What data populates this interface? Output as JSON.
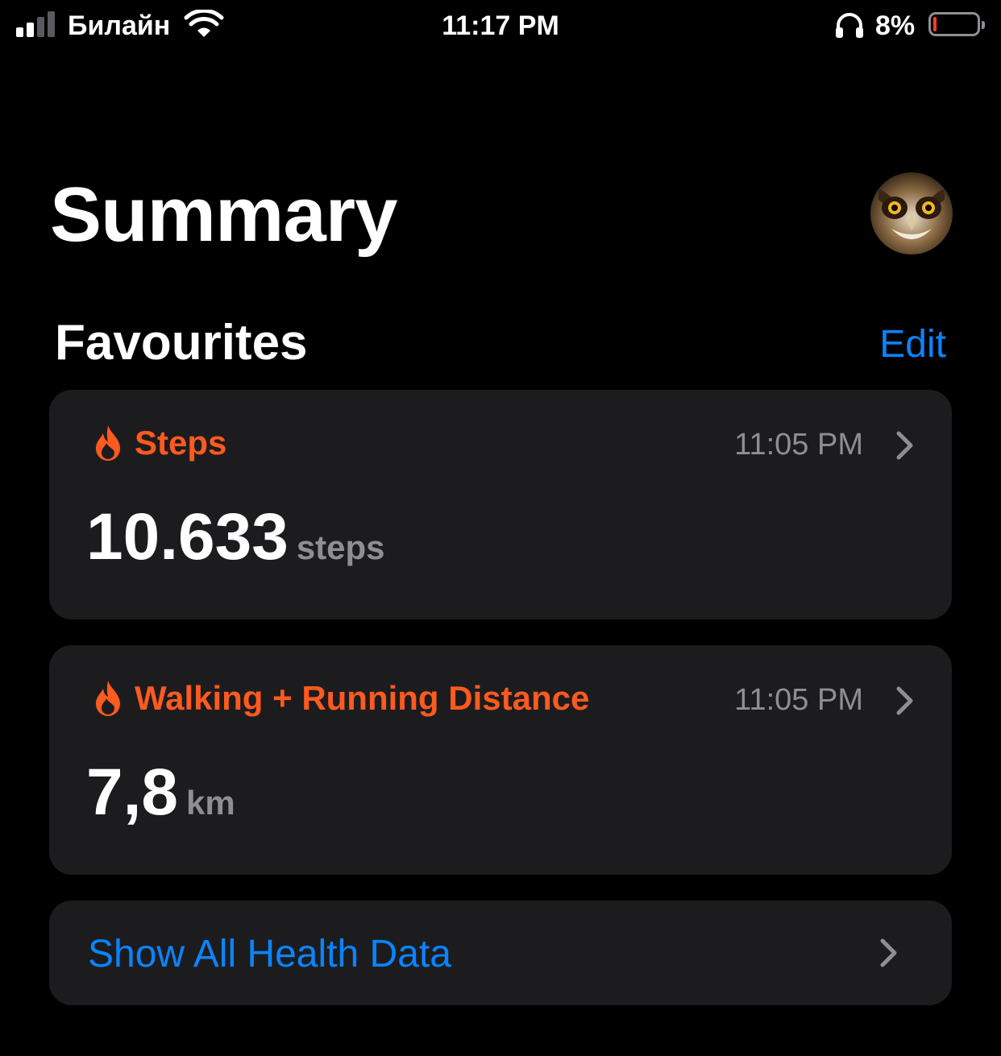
{
  "status_bar": {
    "carrier": "Билайн",
    "time": "11:17 PM",
    "battery_percent": "8%",
    "battery_level": 0.08,
    "signal_bars_active": 2,
    "signal_bars_total": 4,
    "icons": [
      "signal-icon",
      "wifi-icon",
      "headphones-icon",
      "battery-icon"
    ]
  },
  "header": {
    "title": "Summary",
    "avatar_icon": "owl-avatar"
  },
  "favourites": {
    "title": "Favourites",
    "edit_label": "Edit",
    "cards": [
      {
        "title": "Steps",
        "time": "11:05 PM",
        "value": "10.633",
        "unit": "steps",
        "icon": "flame-icon"
      },
      {
        "title": "Walking + Running Distance",
        "time": "11:05 PM",
        "value": "7,8",
        "unit": "km",
        "icon": "flame-icon"
      }
    ]
  },
  "show_all": {
    "label": "Show All Health Data"
  },
  "colors": {
    "background": "#000000",
    "card": "#1c1c1e",
    "accent_orange": "#ff5a1f",
    "link_blue": "#0a84ff",
    "secondary_gray": "#8e8e93",
    "battery_low": "#ff3b30"
  }
}
